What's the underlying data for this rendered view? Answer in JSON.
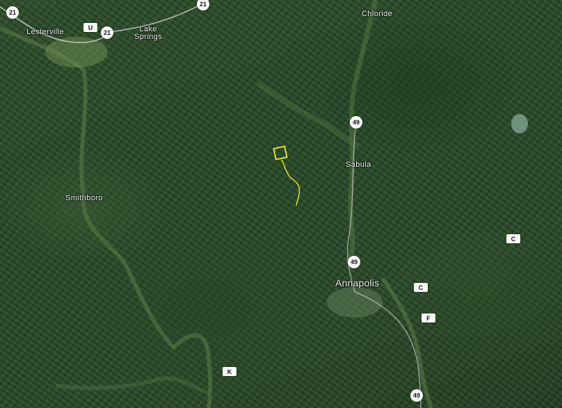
{
  "places": [
    {
      "id": "lesterville",
      "label": "Lesterville"
    },
    {
      "id": "lake-springs",
      "label": "Lake\nSprings"
    },
    {
      "id": "chloride",
      "label": "Chloride"
    },
    {
      "id": "sabula",
      "label": "Sabula"
    },
    {
      "id": "smithboro",
      "label": "Smithboro"
    },
    {
      "id": "annapolis",
      "label": "Annapolis"
    }
  ],
  "route_shields": {
    "r21_a": "21",
    "r21_b": "21",
    "r21_c": "21",
    "ru": "U",
    "r49_a": "49",
    "r49_b": "49",
    "r49_c": "49",
    "rc_a": "C",
    "rc_b": "C",
    "rf": "F",
    "rk": "K"
  },
  "colors": {
    "parcel_outline": "#e8dc2a",
    "road": "#d8d8d8",
    "forest": "#2a4b28"
  }
}
